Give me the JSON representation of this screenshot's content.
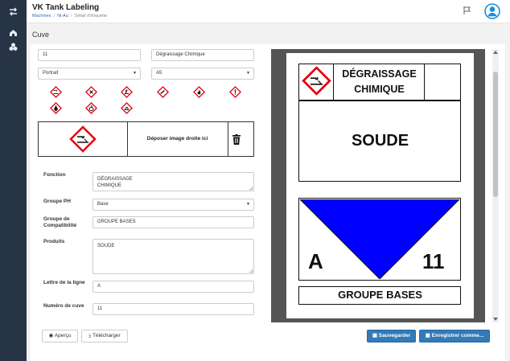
{
  "app": {
    "title": "VK Tank Labeling"
  },
  "breadcrumb": [
    "Machines",
    "Ni-Au",
    "Détail d'étiquette"
  ],
  "page": {
    "title": "Cuve"
  },
  "form": {
    "tank_number": "11",
    "label_title": "Dégraissage Chimique",
    "orientation": "Portrait",
    "paper_size": "A5",
    "dropzone_text": "Déposer image droite ici",
    "fonction_label": "Fonction",
    "fonction_value": "DÉGRAISSAGE\nCHIMIQUE",
    "groupe_ph_label": "Groupe PH",
    "groupe_ph_value": "Base",
    "compat_label": "Groupe de Compatibilité",
    "compat_value": "GROUPE BASES",
    "produits_label": "Produits",
    "produits_value": "SOUDE",
    "lettre_label": "Lettre de la ligne",
    "lettre_value": "A",
    "numero_label": "Numéro de cuve",
    "numero_value": "11"
  },
  "pictograms": [
    "ghs05-corrosive-icon",
    "ghs07-exclamation-icon",
    "ghs09-environment-icon",
    "ghs04-gas-cylinder-icon",
    "ghs02-flame-icon",
    "ghs07-exclamation-icon",
    "ghs06-skull-icon",
    "ghs03-oxidizer-icon",
    "ghs08-health-hazard-icon"
  ],
  "buttons": {
    "apercu": "Aperçu",
    "telecharger": "Télécharger",
    "sauvegarder": "Sauvegarder",
    "enregistrer": "Enregistrer comme..."
  },
  "preview": {
    "title": "DÉGRAISSAGE\nCHIMIQUE",
    "product": "SOUDE",
    "letter": "A",
    "number": "11",
    "group": "GROUPE BASES",
    "group_color": "#0000ff"
  },
  "colors": {
    "sidebar": "#263445",
    "primary": "#337ab7",
    "hazard_red": "#e3000f",
    "link": "#2a6cb5"
  }
}
